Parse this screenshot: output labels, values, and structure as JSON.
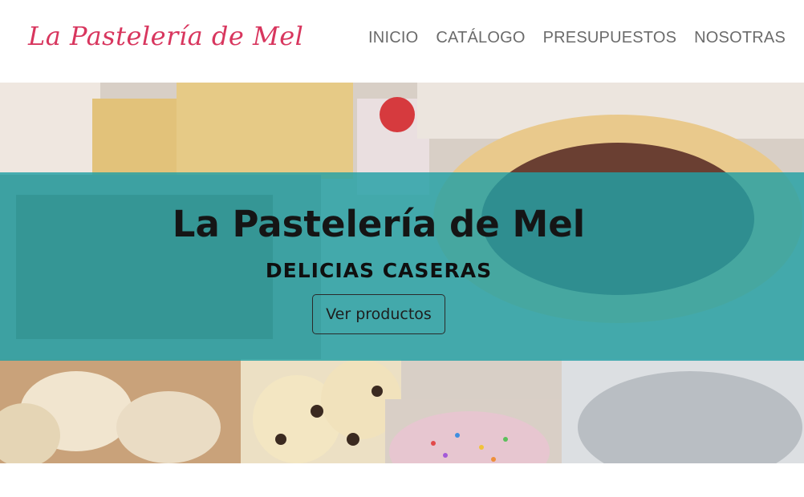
{
  "navbar": {
    "brand": "La Pastelería de Mel",
    "links": [
      "INICIO",
      "CATÁLOGO",
      "PRESUPUESTOS",
      "NOSOTRAS"
    ]
  },
  "hero": {
    "title": "La Pastelería de Mel",
    "subtitle": "DELICIAS CASERAS",
    "button_label": "Ver productos"
  },
  "colors": {
    "brand": "#d8365e",
    "overlay": "#22a0a5",
    "nav_text": "#6b6b6b"
  }
}
